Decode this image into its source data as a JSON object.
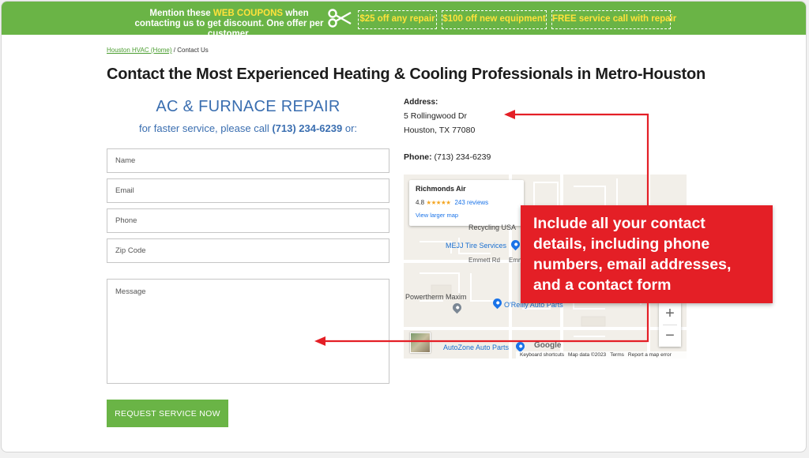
{
  "banner": {
    "text_pre": "Mention these ",
    "text_highlight": "WEB COUPONS",
    "text_post": " when contacting us to get discount. One offer per customer.",
    "coupons": [
      "$25 off any repair",
      "$100 off new equipment",
      "FREE service call with repair"
    ],
    "icon": "scissors-icon",
    "color": "#6ab446",
    "highlight_color": "#ffe23b"
  },
  "breadcrumb": {
    "home": "Houston HVAC (Home)",
    "separator": " / ",
    "current": "Contact Us"
  },
  "page_title": "Contact the Most Experienced Heating & Cooling Professionals in Metro-Houston",
  "form": {
    "heading": "AC & FURNACE REPAIR",
    "sub_pre": "for faster service, please call ",
    "sub_phone": "(713) 234-6239",
    "sub_post": " or:",
    "placeholders": {
      "name": "Name",
      "email": "Email",
      "phone": "Phone",
      "zip": "Zip Code",
      "message": "Message"
    },
    "submit_label": "REQUEST SERVICE NOW",
    "accent_color": "#3a6eb0"
  },
  "contact": {
    "address_label": "Address:",
    "address_line1": "5 Rollingwood Dr",
    "address_line2": "Houston, TX 77080",
    "phone_label": "Phone:",
    "phone_value": " (713) 234-6239"
  },
  "map": {
    "card_name": "Richmonds Air",
    "rating": "4.8",
    "stars": "★★★★★",
    "reviews": "243 reviews",
    "larger_link": "View larger map",
    "labels": {
      "recycling": "Recycling USA",
      "mejj": "MEJJ Tire Services",
      "emmett": "Emmett Rd",
      "emm": "Emm",
      "powertherm": "Powertherm Maxim",
      "oreilly": "O'Reilly Auto Parts",
      "autozone": "AutoZone Auto Parts"
    },
    "zoom_in": "+",
    "zoom_out": "−",
    "google": "Google",
    "footer": {
      "shortcuts": "Keyboard shortcuts",
      "data": "Map data ©2023",
      "terms": "Terms",
      "report": "Report a map error"
    }
  },
  "callout": {
    "text": "Include all your contact details, including phone numbers, email addresses, and a contact form",
    "color": "#e41f26"
  }
}
